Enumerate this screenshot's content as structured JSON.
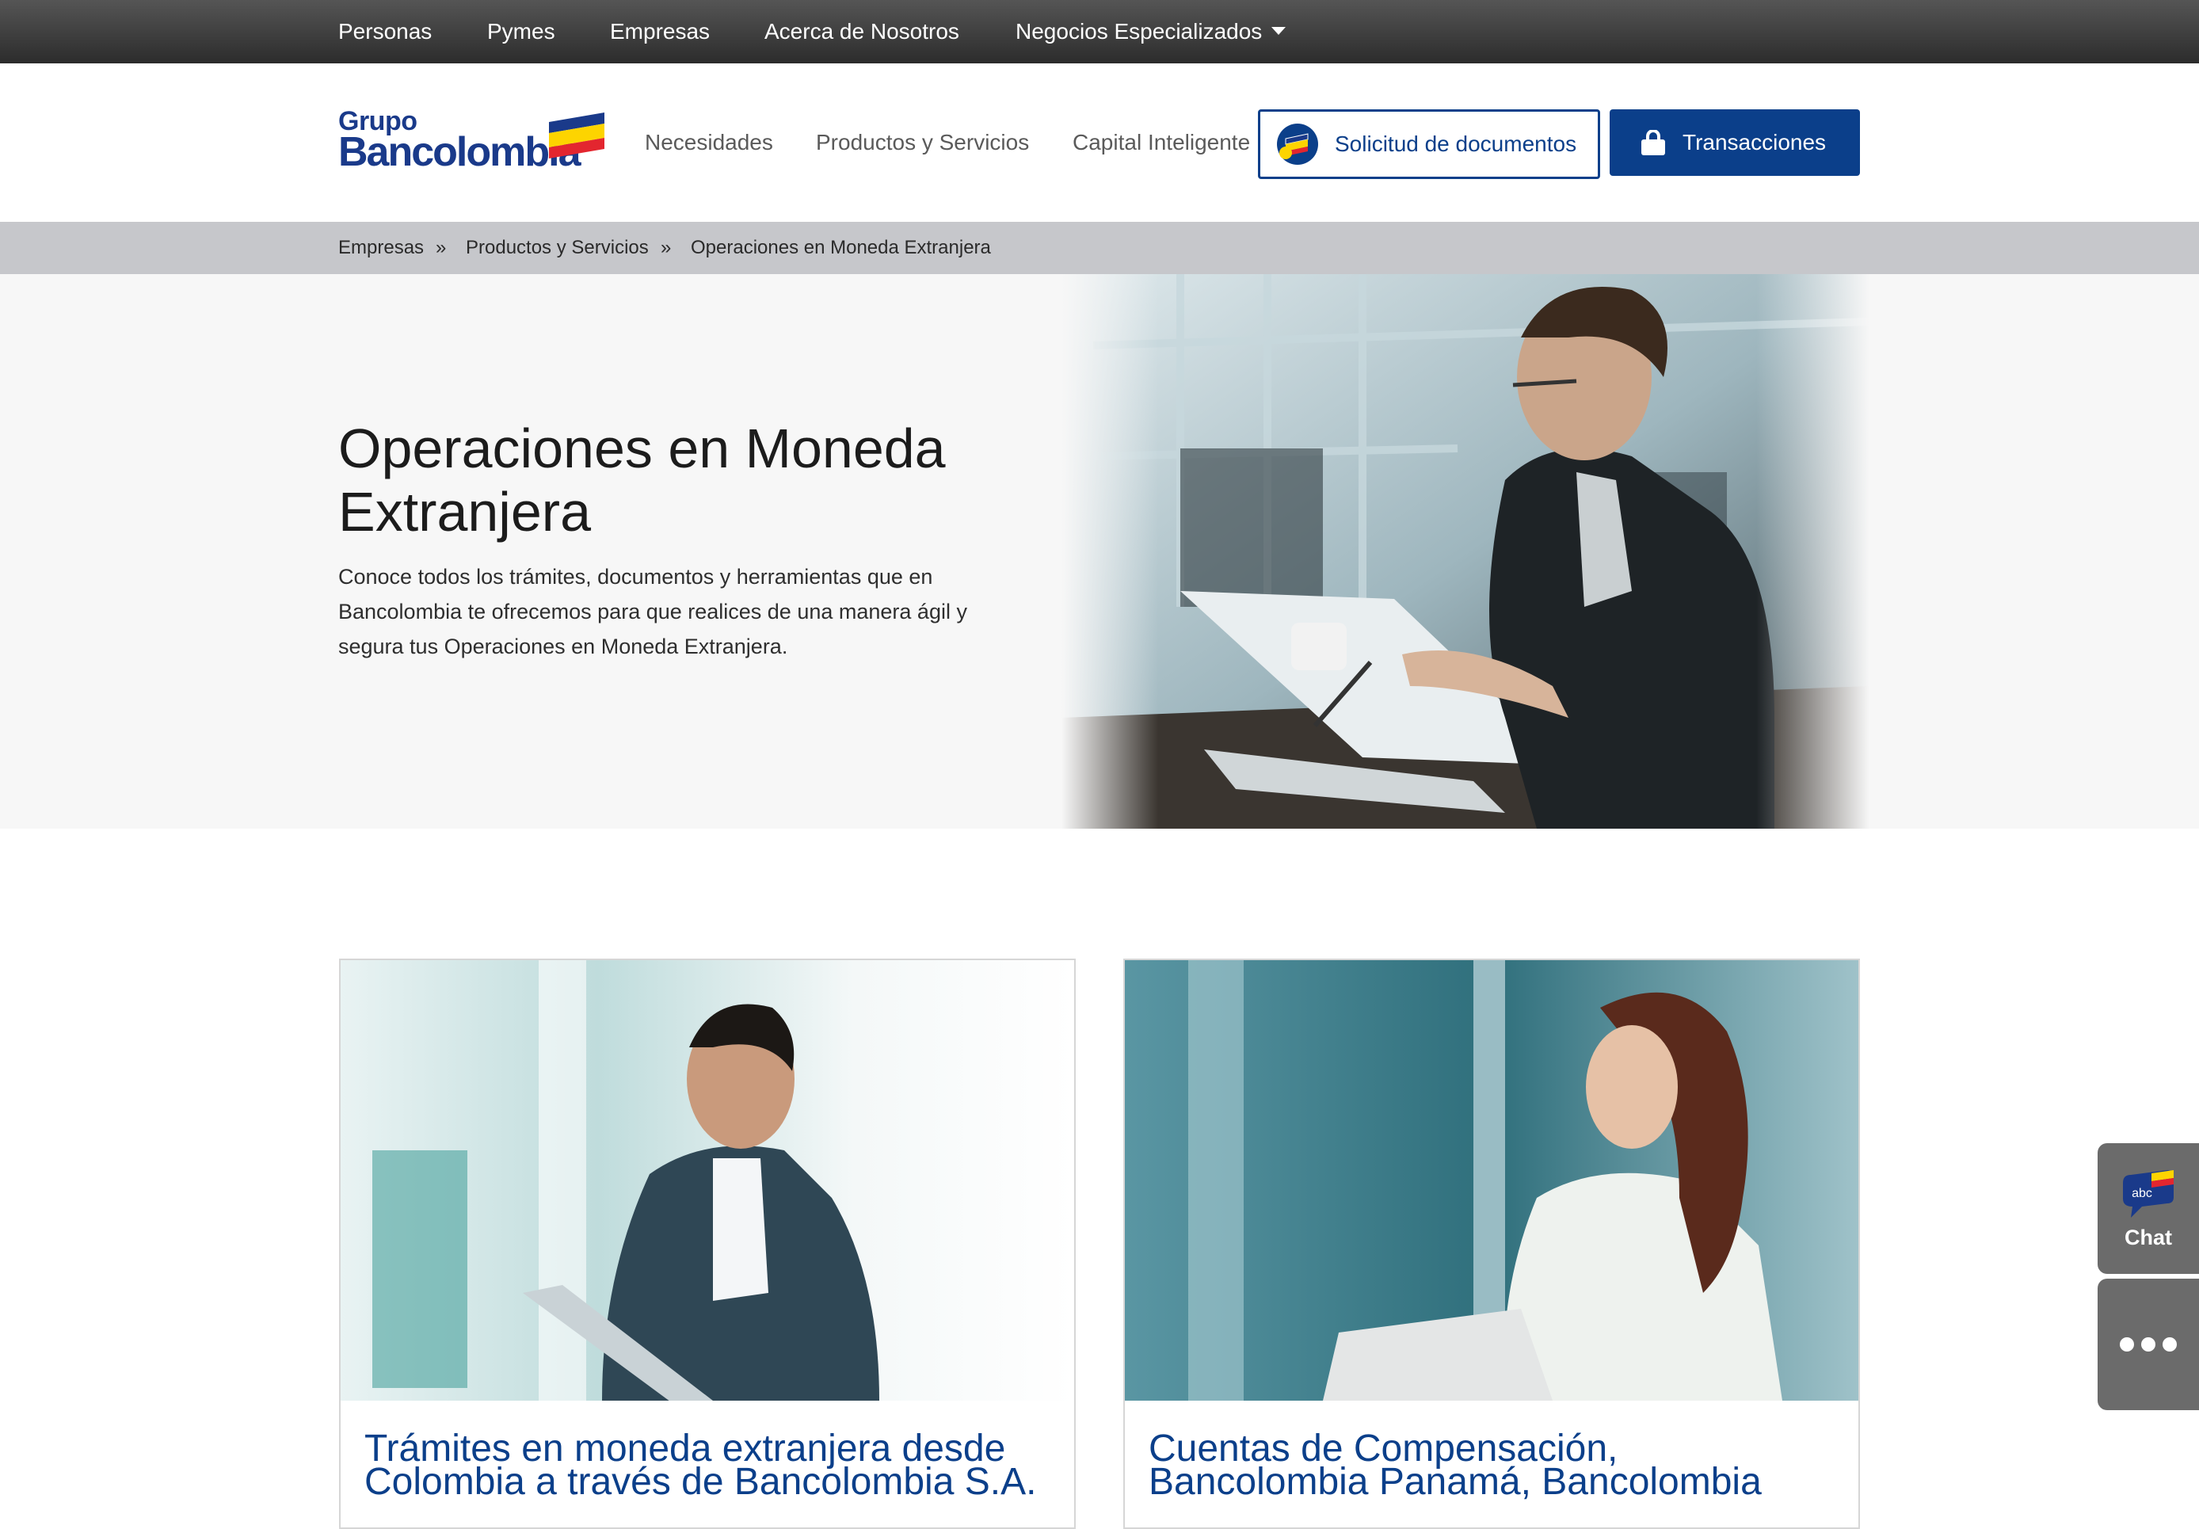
{
  "topnav": {
    "items": [
      {
        "label": "Personas"
      },
      {
        "label": "Pymes"
      },
      {
        "label": "Empresas"
      },
      {
        "label": "Acerca de Nosotros"
      },
      {
        "label": "Negocios Especializados"
      }
    ]
  },
  "header": {
    "logo": {
      "line1": "Grupo",
      "line2": "Bancolombia"
    },
    "nav": [
      {
        "label": "Necesidades"
      },
      {
        "label": "Productos y Servicios"
      },
      {
        "label": "Capital Inteligente"
      }
    ],
    "docs_button": "Solicitud de documentos",
    "transactions_button": "Transacciones"
  },
  "breadcrumb": {
    "items": [
      "Empresas",
      "Productos y Servicios",
      "Operaciones en Moneda Extranjera"
    ],
    "separator": "»"
  },
  "hero": {
    "title": "Operaciones en Moneda Extranjera",
    "description": "Conoce todos los trámites, documentos y herramientas que en Bancolombia te ofrecemos para que realices de una manera ágil y segura tus Operaciones en Moneda Extranjera."
  },
  "cards": [
    {
      "title": "Trámites en moneda extranjera desde Colombia a través de Bancolombia S.A."
    },
    {
      "title": "Cuentas de Compensación, Bancolombia Panamá, Bancolombia"
    }
  ],
  "floating": {
    "chat_badge": "abc",
    "chat_label": "Chat"
  },
  "colors": {
    "brand_blue": "#0b3f8a",
    "flag_yellow": "#fdd400",
    "flag_blue": "#1a3a8a",
    "flag_red": "#e3262f"
  }
}
